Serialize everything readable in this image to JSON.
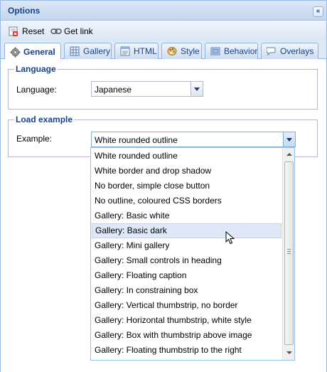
{
  "panel": {
    "title": "Options",
    "collapse_glyph": "«"
  },
  "toolbar": {
    "reset_label": "Reset",
    "getlink_label": "Get link"
  },
  "tabs": [
    {
      "label": "General",
      "icon": "gear-icon",
      "active": true
    },
    {
      "label": "Gallery",
      "icon": "grid-icon",
      "active": false
    },
    {
      "label": "HTML",
      "icon": "html-icon",
      "active": false
    },
    {
      "label": "Style",
      "icon": "palette-icon",
      "active": false
    },
    {
      "label": "Behavior",
      "icon": "behavior-icon",
      "active": false
    },
    {
      "label": "Overlays",
      "icon": "overlays-icon",
      "active": false
    }
  ],
  "language_section": {
    "legend": "Language",
    "label": "Language:",
    "value": "Japanese"
  },
  "example_section": {
    "legend": "Load example",
    "label": "Example:",
    "value": "White rounded outline",
    "options": [
      "White rounded outline",
      "White border and drop shadow",
      "No border, simple close button",
      "No outline, coloured CSS borders",
      "Gallery: Basic white",
      "Gallery: Basic dark",
      "Gallery: Mini gallery",
      "Gallery: Small controls in heading",
      "Gallery: Floating caption",
      "Gallery: In constraining box",
      "Gallery: Vertical thumbstrip, no border",
      "Gallery: Horizontal thumbstrip, white style",
      "Gallery: Box with thumbstrip above image",
      "Gallery: Floating thumbstrip to the right"
    ],
    "hovered_option": "Gallery: Basic dark"
  },
  "colors": {
    "header_text": "#15428b",
    "border": "#99bbe8",
    "hover_bg": "#dfe8f6"
  }
}
